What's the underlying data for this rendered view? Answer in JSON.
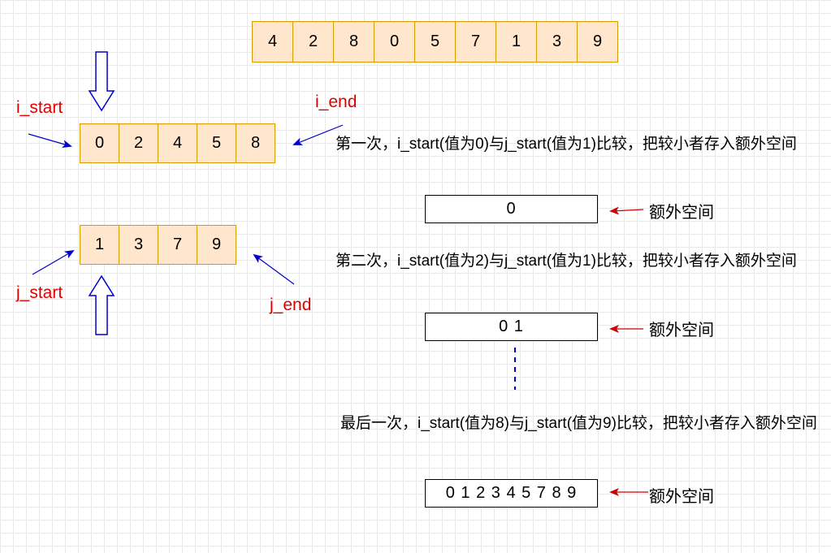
{
  "source_array": [
    "4",
    "2",
    "8",
    "0",
    "5",
    "7",
    "1",
    "3",
    "9"
  ],
  "left_array": [
    "0",
    "2",
    "4",
    "5",
    "8"
  ],
  "right_array": [
    "1",
    "3",
    "7",
    "9"
  ],
  "pointers": {
    "i_start": "i_start",
    "i_end": "i_end",
    "j_start": "j_start",
    "j_end": "j_end"
  },
  "steps": [
    {
      "text": "第一次，i_start(值为0)与j_start(值为1)比较，把较小者存入额外空间",
      "buffer": "0",
      "buffer_label": "额外空间"
    },
    {
      "text": "第二次，i_start(值为2)与j_start(值为1)比较，把较小者存入额外空间",
      "buffer": "0 1",
      "buffer_label": "额外空间"
    },
    {
      "text": "最后一次，i_start(值为8)与j_start(值为9)比较，把较小者存入额外空间",
      "buffer": "0 1 2 3 4 5 7 8 9",
      "buffer_label": "额外空间"
    }
  ],
  "colors": {
    "cell_fill": "#ffe6cc",
    "cell_border": "#d79b00",
    "pointer_arrow": "#0000cc",
    "label_red": "#e00000",
    "buffer_arrow": "#cc0000",
    "dashed_line": "#0000cc"
  }
}
